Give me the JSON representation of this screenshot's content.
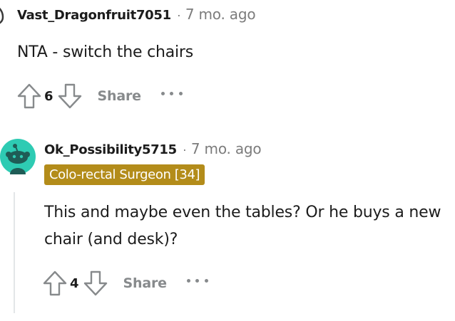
{
  "comments": [
    {
      "username": "Vast_Dragonfruit7051",
      "separator": "·",
      "timestamp": "7 mo. ago",
      "body": "NTA - switch the chairs",
      "votes": "6",
      "share_label": "Share",
      "avatar_icon": "partial-avatar-icon"
    },
    {
      "username": "Ok_Possibility5715",
      "separator": "·",
      "timestamp": "7 mo. ago",
      "flair": "Colo-rectal Surgeon [34]",
      "body": "This and maybe even the tables? Or he buys a new chair (and desk)?",
      "votes": "4",
      "share_label": "Share",
      "avatar_icon": "snoo-avatar-icon"
    }
  ],
  "colors": {
    "flair_bg": "#b38c1a",
    "avatar_bg": "#2ecbb3",
    "muted": "#878a8c",
    "text": "#1c1c1c"
  },
  "icons": [
    "upvote-icon",
    "downvote-icon",
    "more-options-icon"
  ]
}
